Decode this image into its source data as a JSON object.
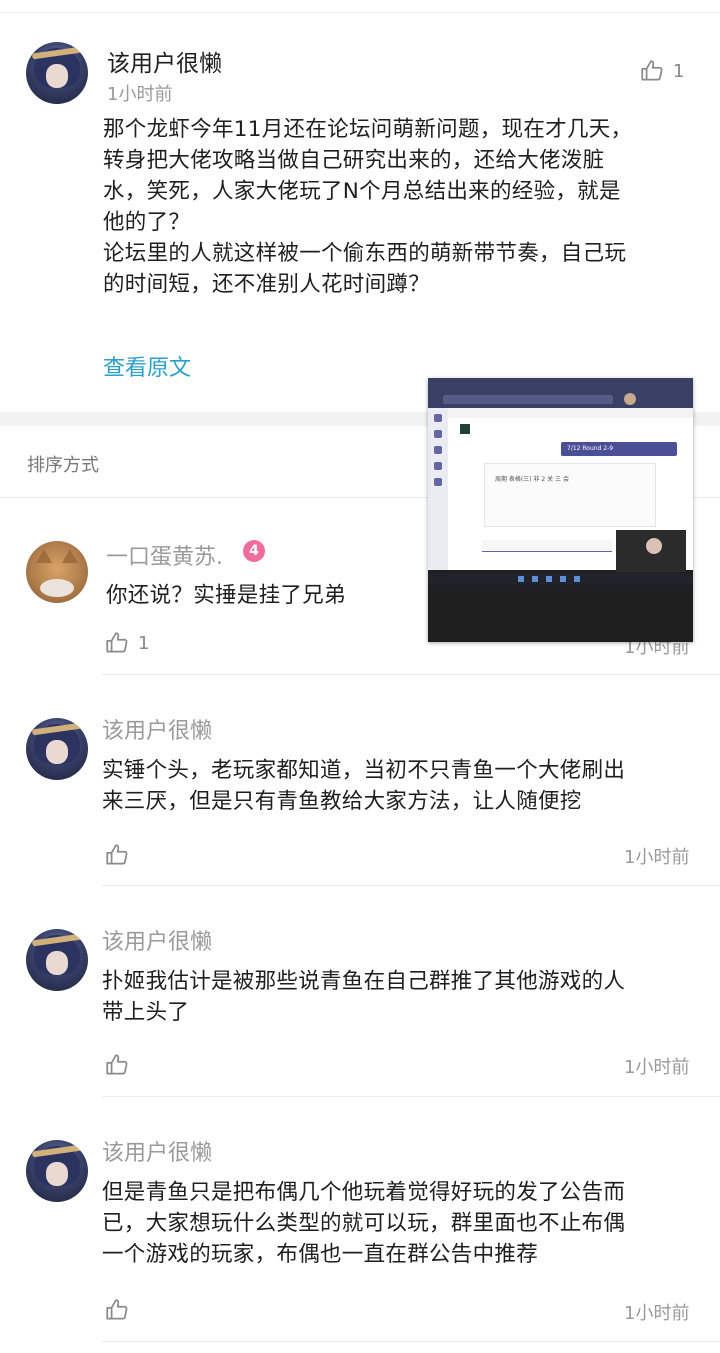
{
  "main_post": {
    "username": "该用户很懒",
    "time": "1小时前",
    "like_count": "1",
    "content_lines": [
      "那个龙虾今年11月还在论坛问萌新问题，现在才几天，",
      "转身把大佬攻略当做自己研究出来的，还给大佬泼脏",
      "水，笑死，人家大佬玩了N个月总结出来的经验，就是",
      "他的了？",
      "论坛里的人就这样被一个偷东西的萌新带节奏，自己玩",
      "的时间短，还不准别人花时间蹲？"
    ],
    "view_original": "查看原文"
  },
  "sort": {
    "label": "排序方式"
  },
  "comments": [
    {
      "username": "一口蛋黄苏.",
      "level": "4",
      "content_lines": [
        "你还说？实捶是挂了兄弟"
      ],
      "like_count": "1",
      "time": "1小时前"
    },
    {
      "username": "该用户很懒",
      "content_lines": [
        "实锤个头，老玩家都知道，当初不只青鱼一个大佬刷出",
        "来三厌，但是只有青鱼教给大家方法，让人随便挖"
      ],
      "like_count": "",
      "time": "1小时前"
    },
    {
      "username": "该用户很懒",
      "content_lines": [
        "扑姬我估计是被那些说青鱼在自己群推了其他游戏的人",
        "带上头了"
      ],
      "like_count": "",
      "time": "1小时前"
    },
    {
      "username": "该用户很懒",
      "content_lines": [
        "但是青鱼只是把布偶几个他玩着觉得好玩的发了公告而",
        "已，大家想玩什么类型的就可以玩，群里面也不止布偶",
        "一个游戏的玩家，布偶也一直在群公告中推荐"
      ],
      "like_count": "",
      "time": "1小时前"
    }
  ],
  "overlay": {
    "banner_text": "7/12 Round 2-9",
    "card_title": "周期 表格(三) 非 2 关 三 会"
  },
  "colors": {
    "link": "#2a9fc9",
    "badge": "#f06c9b",
    "muted": "#9a9a9a"
  },
  "icons": [
    "thumbs-up-icon"
  ]
}
